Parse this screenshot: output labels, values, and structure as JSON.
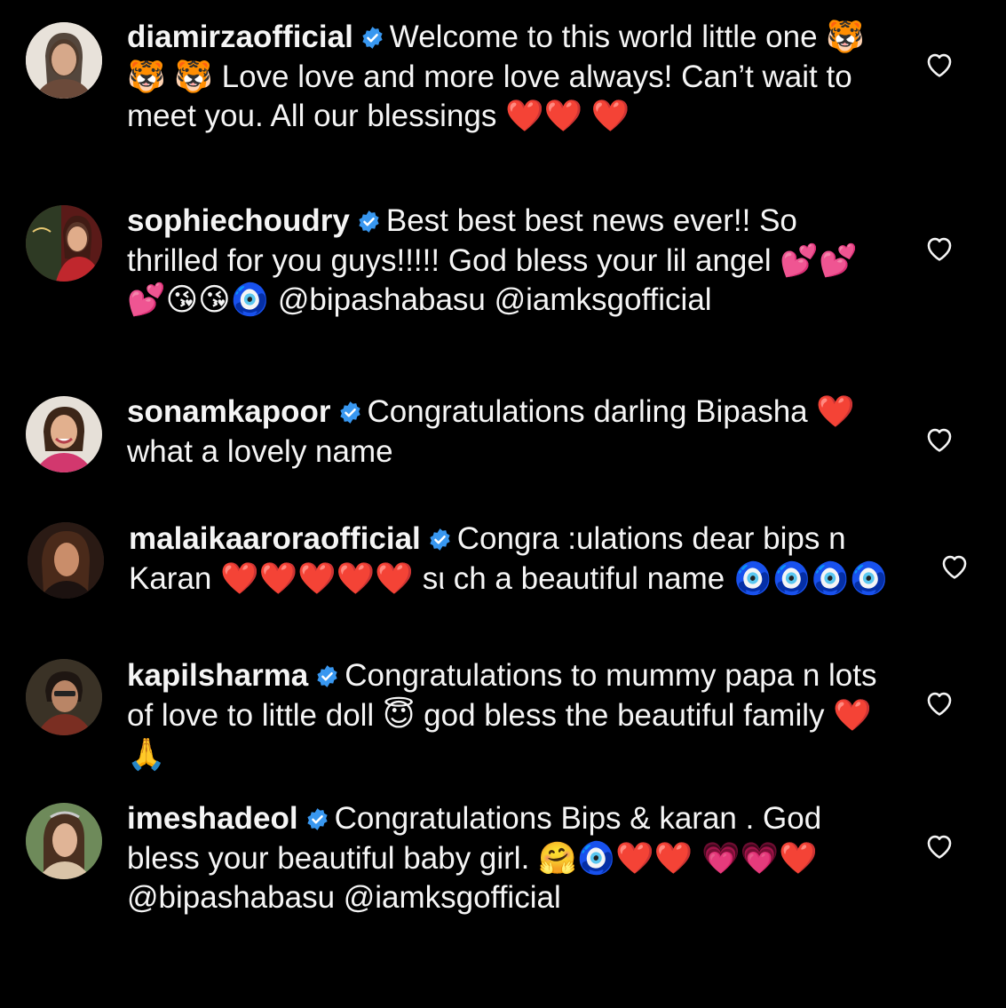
{
  "colors": {
    "background": "#000000",
    "text": "#f5f5f5",
    "verified_badge": "#3897f0",
    "heart_outline": "#f5f5f5"
  },
  "icons": {
    "verified": "verified-badge-icon",
    "like": "heart-outline-icon"
  },
  "comments": [
    {
      "username": "diamirzaofficial",
      "verified": true,
      "text": "Welcome to this world little one 🐯 🐯 🐯 Love love and more love always! Can’t wait to meet you. All our blessings ❤️❤️ ❤️"
    },
    {
      "username": "sophiechoudry",
      "verified": true,
      "text": "Best best best news ever!! So thrilled for you guys!!!!! God bless your lil angel 💕💕💕😘😘🧿 @bipashabasu @iamksgofficial"
    },
    {
      "username": "sonamkapoor",
      "verified": true,
      "text": "Congratulations darling Bipasha ❤️what a lovely name"
    },
    {
      "username": "malaikaaroraofficial",
      "verified": true,
      "text": "Congra :ulations dear bips n Karan ❤️❤️❤️❤️❤️ sι ch a beautiful name 🧿🧿🧿🧿"
    },
    {
      "username": "kapilsharma",
      "verified": true,
      "text": "Congratulations to mummy papa n lots of love to little doll 😇 god bless the beautiful family ❤️🙏"
    },
    {
      "username": "imeshadeol",
      "verified": true,
      "text": "Congratulations Bips & karan . God bless your beautiful baby girl. 🤗🧿❤️❤️ 💗💗❤️ @bipashabasu @iamksgofficial"
    }
  ]
}
